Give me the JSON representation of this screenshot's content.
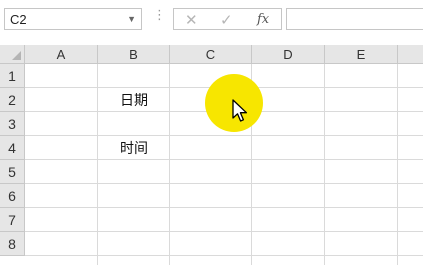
{
  "formula_bar": {
    "name_box": "C2",
    "formula_value": ""
  },
  "grid": {
    "columns": [
      "A",
      "B",
      "C",
      "D",
      "E"
    ],
    "rows": [
      "1",
      "2",
      "3",
      "4",
      "5",
      "6",
      "7",
      "8"
    ],
    "selected_cell": "C2",
    "cells": {
      "B2": "日期",
      "B4": "时间"
    }
  },
  "cursor": {
    "highlight_color": "#f7e600",
    "icon": "mouse-pointer-icon"
  }
}
